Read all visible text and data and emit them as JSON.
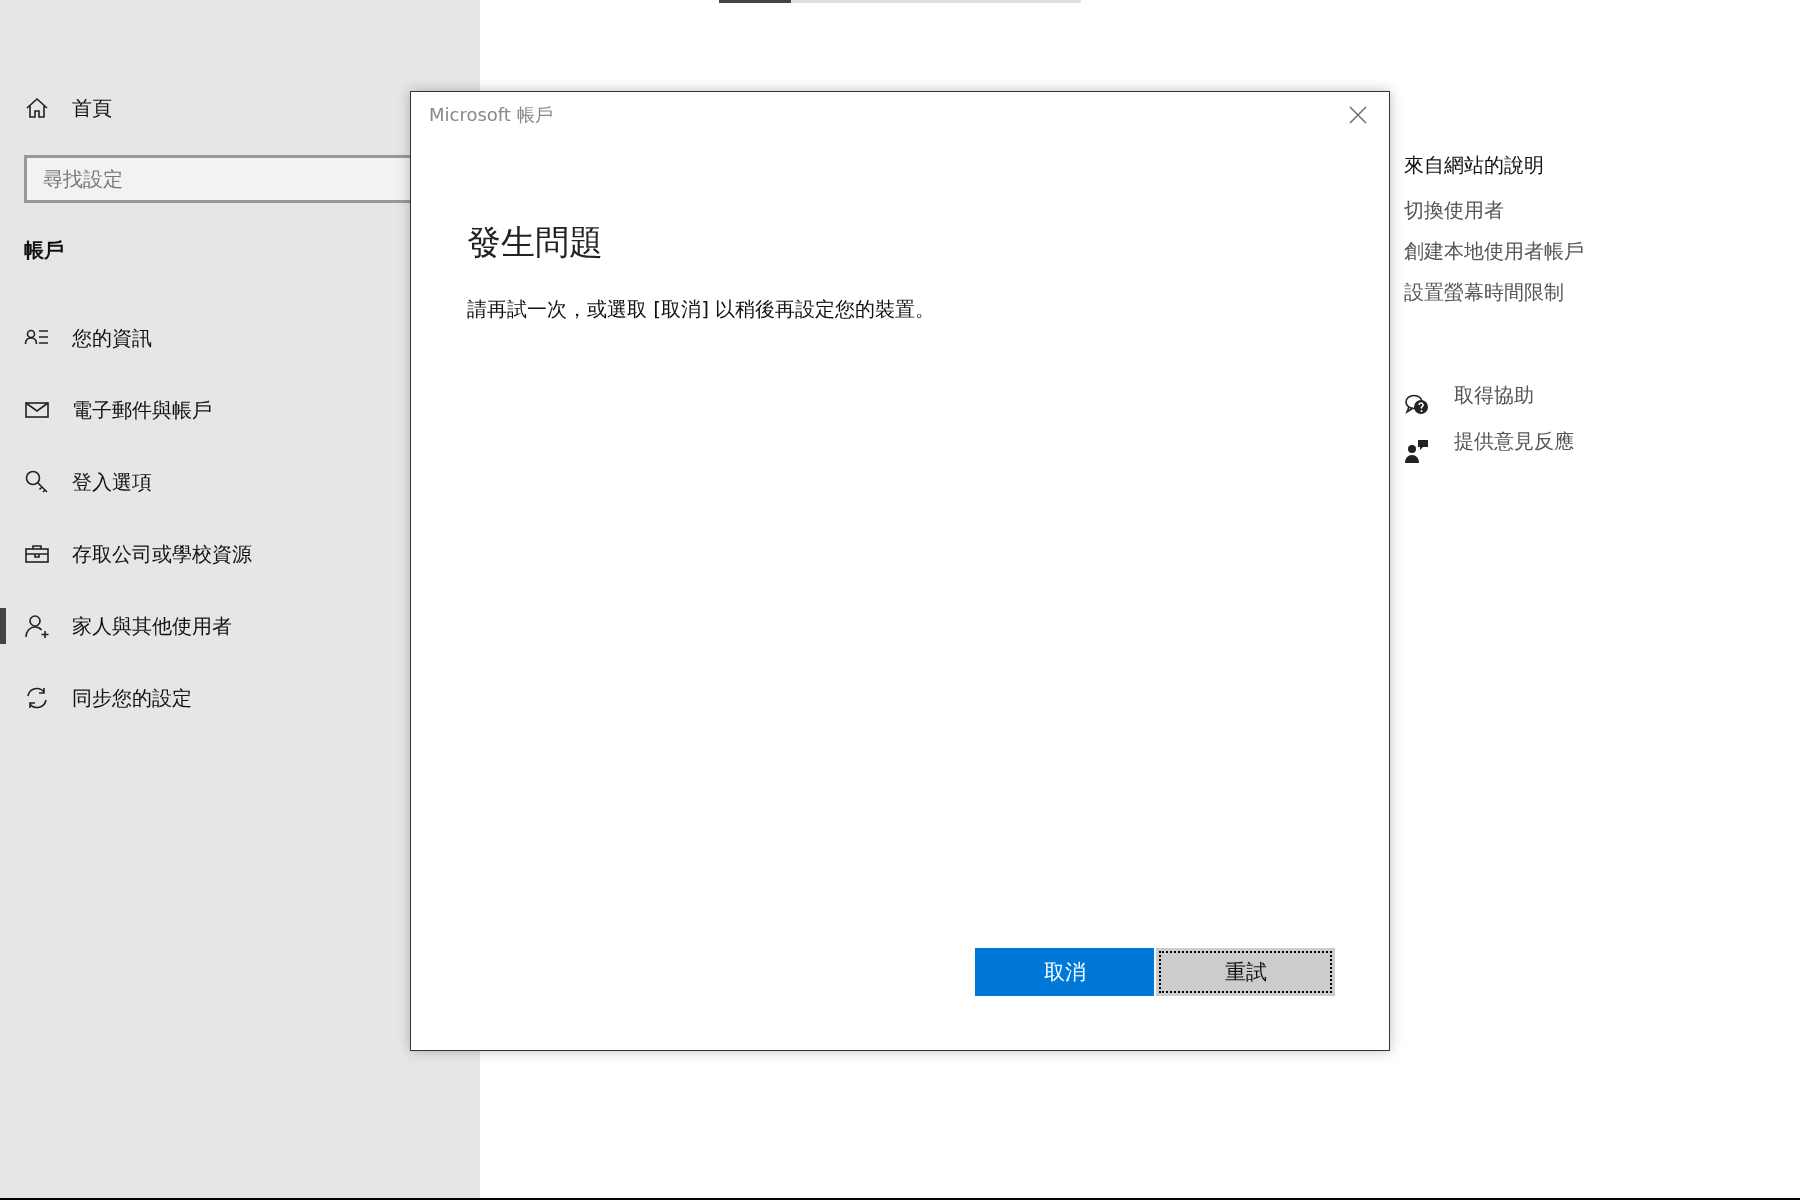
{
  "sidebar": {
    "home": "首頁",
    "search": {
      "placeholder": "尋找設定"
    },
    "section": "帳戶",
    "items": [
      {
        "label": "您的資訊",
        "kind": "info",
        "selected": false
      },
      {
        "label": "電子郵件與帳戶",
        "kind": "mail",
        "selected": false
      },
      {
        "label": "登入選項",
        "kind": "key",
        "selected": false
      },
      {
        "label": "存取公司或學校資源",
        "kind": "briefcase",
        "selected": false
      },
      {
        "label": "家人與其他使用者",
        "kind": "family",
        "selected": true
      },
      {
        "label": "同步您的設定",
        "kind": "sync",
        "selected": false
      }
    ]
  },
  "progress": {
    "level": 0.2
  },
  "help": {
    "title": "來自網站的說明",
    "links": [
      "切換使用者",
      "創建本地使用者帳戶",
      "設置螢幕時間限制"
    ],
    "actions": [
      {
        "label": "取得協助",
        "kind": "help"
      },
      {
        "label": "提供意見反應",
        "kind": "feedback"
      }
    ]
  },
  "dialog": {
    "title": "Microsoft 帳戶",
    "heading": "發生問題",
    "message": "請再試一次，或選取 [取消] 以稍後再設定您的裝置。",
    "buttons": [
      {
        "label": "取消",
        "kind": "primary",
        "focused": false
      },
      {
        "label": "重試",
        "kind": "secondary",
        "focused": true
      }
    ]
  }
}
